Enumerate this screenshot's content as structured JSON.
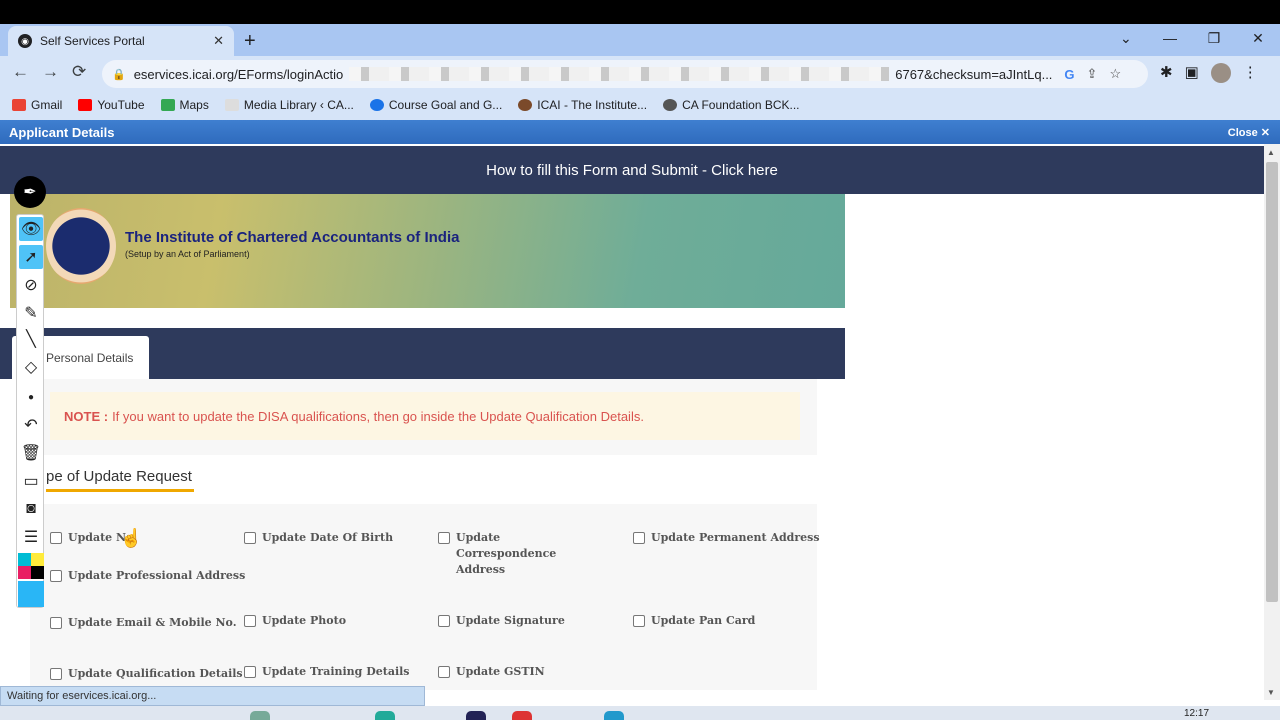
{
  "browser": {
    "tab_title": "Self Services Portal",
    "new_tab": "+",
    "url_start": "eservices.icai.org/EForms/loginActio",
    "url_end": "6767&checksum=aJIntLq...",
    "back": "←",
    "forward": "→",
    "reload": "⟳",
    "status_text": "Waiting for eservices.icai.org..."
  },
  "bookmarks": [
    {
      "label": "Gmail",
      "color": "#ea4335"
    },
    {
      "label": "YouTube",
      "color": "#ff0000"
    },
    {
      "label": "Maps",
      "color": "#34a853"
    },
    {
      "label": "Media Library ‹ CA...",
      "color": "#bbbbbb"
    },
    {
      "label": "Course Goal and G...",
      "color": "#1a73e8"
    },
    {
      "label": "ICAI - The Institute...",
      "color": "#7b4a2a"
    },
    {
      "label": "CA Foundation BCK...",
      "color": "#555555"
    }
  ],
  "dialog": {
    "title": "Applicant Details",
    "close_label": "Close ✕"
  },
  "page": {
    "howto_link": "How to fill this Form and Submit - Click here",
    "institute_name": "The Institute of Chartered Accountants of India",
    "institute_sub": "(Setup by an Act of Parliament)",
    "tab_label": "Personal Details",
    "note_label": "NOTE :",
    "note_text": "If you want to update the DISA qualifications, then go inside the Update Qualification Details.",
    "section_title": "pe of Update Request"
  },
  "checkboxes": [
    {
      "label": "Update Na"
    },
    {
      "label": "Update Date Of Birth"
    },
    {
      "label": "Update Correspondence Address"
    },
    {
      "label": "Update Permanent Address"
    },
    {
      "label": "Update Professional Address"
    },
    {
      "label": "Update Email & Mobile No."
    },
    {
      "label": "Update Photo"
    },
    {
      "label": "Update Signature"
    },
    {
      "label": "Update Pan Card"
    },
    {
      "label": "Update Qualification Details"
    },
    {
      "label": "Update Training Details"
    },
    {
      "label": "Update GSTIN"
    }
  ],
  "clock": "12:17"
}
